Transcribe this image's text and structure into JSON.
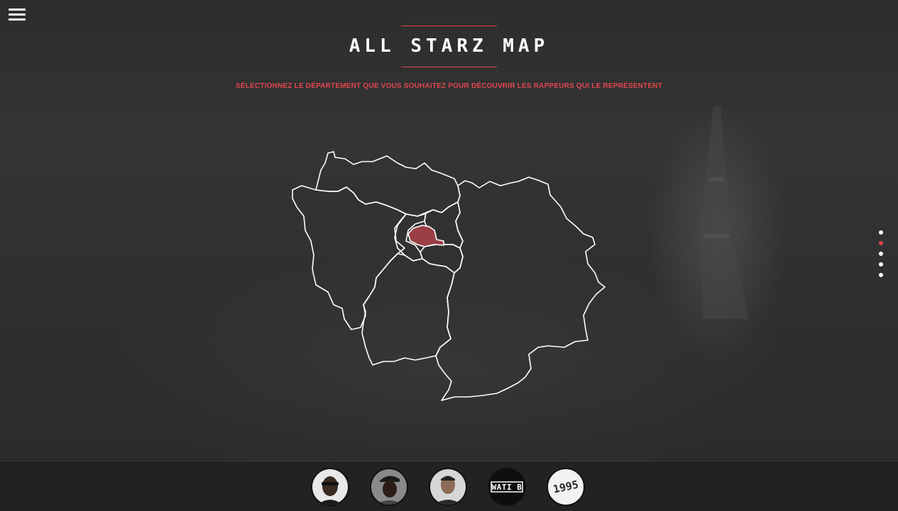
{
  "page": {
    "title": "ALL STARZ MAP",
    "subtitle": "SÉLECTIONNEZ LE DÉPARTEMENT QUE VOUS SOUHAITEZ POUR DÉCOUVRIR LES RAPPEURS QUI LE REPRÉSENTENT"
  },
  "colors": {
    "accent": "#e0464f",
    "selected_department": "#9b3f47",
    "background": "#2f2f2f",
    "bottom_bar": "#222222"
  },
  "icons": {
    "menu": "hamburger-menu-icon"
  },
  "map": {
    "region": "Île-de-France",
    "selected_department": "Paris"
  },
  "pagination": {
    "count": 5,
    "active_index": 1
  },
  "bottom_bar": {
    "avatars": [
      {
        "type": "photo",
        "name": "artist-1"
      },
      {
        "type": "photo",
        "name": "artist-2"
      },
      {
        "type": "photo",
        "name": "artist-3"
      },
      {
        "type": "logo",
        "text": "WATI B"
      },
      {
        "type": "logo",
        "text": "1995"
      }
    ]
  }
}
